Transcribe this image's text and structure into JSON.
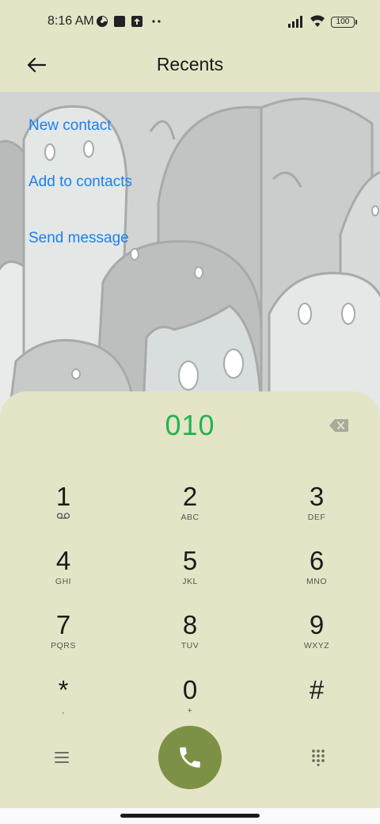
{
  "status_bar": {
    "time": "8:16 AM",
    "battery_level": "100",
    "icons": [
      "app-notification-icon",
      "square-notification-icon",
      "upload-notification-icon",
      "more-notifications-icon",
      "signal-icon",
      "wifi-icon",
      "battery-icon"
    ]
  },
  "app_bar": {
    "title": "Recents",
    "back_icon": "arrow-left-icon"
  },
  "actions": {
    "new_contact": "New contact",
    "add_to_contacts": "Add to contacts",
    "send_message": "Send message"
  },
  "dialer": {
    "number": "010",
    "backspace_icon": "backspace-icon",
    "keys": [
      {
        "digit": "1",
        "letters": ""
      },
      {
        "digit": "2",
        "letters": "ABC"
      },
      {
        "digit": "3",
        "letters": "DEF"
      },
      {
        "digit": "4",
        "letters": "GHI"
      },
      {
        "digit": "5",
        "letters": "JKL"
      },
      {
        "digit": "6",
        "letters": "MNO"
      },
      {
        "digit": "7",
        "letters": "PQRS"
      },
      {
        "digit": "8",
        "letters": "TUV"
      },
      {
        "digit": "9",
        "letters": "WXYZ"
      },
      {
        "digit": "*",
        "letters": ","
      },
      {
        "digit": "0",
        "letters": "+"
      },
      {
        "digit": "#",
        "letters": ""
      }
    ],
    "menu_icon": "menu-icon",
    "call_icon": "phone-icon",
    "keypad_icon": "dialpad-icon"
  },
  "colors": {
    "background": "#e4e4c7",
    "link": "#1a80f0",
    "number": "#23b34f",
    "call_button": "#7c9145"
  }
}
